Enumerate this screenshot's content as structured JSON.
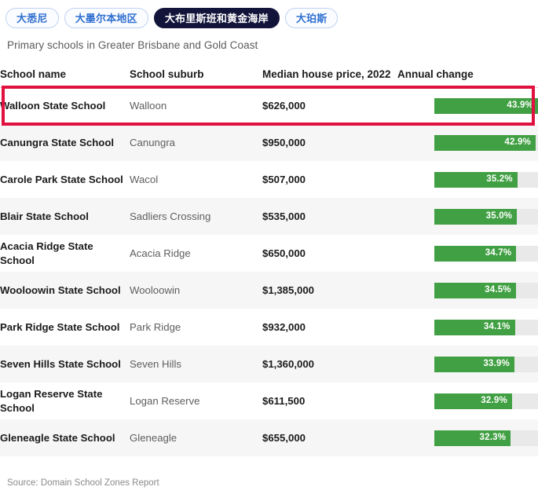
{
  "tabs": [
    {
      "label": "大悉尼",
      "active": false
    },
    {
      "label": "大墨尔本地区",
      "active": false
    },
    {
      "label": "大布里斯班和黄金海岸",
      "active": true
    },
    {
      "label": "大珀斯",
      "active": false
    }
  ],
  "subtitle": "Primary schools in Greater Brisbane and Gold Coast",
  "table": {
    "headers": {
      "school_name": "School name",
      "school_suburb": "School suburb",
      "median_price": "Median house price, 2022",
      "annual_change": "Annual change"
    },
    "rows": [
      {
        "school": "Walloon State School",
        "suburb": "Walloon",
        "price": "$626,000",
        "change_label": "43.9%",
        "change_value": 43.9,
        "highlighted": true
      },
      {
        "school": "Canungra State School",
        "suburb": "Canungra",
        "price": "$950,000",
        "change_label": "42.9%",
        "change_value": 42.9,
        "highlighted": false
      },
      {
        "school": "Carole Park State School",
        "suburb": "Wacol",
        "price": "$507,000",
        "change_label": "35.2%",
        "change_value": 35.2,
        "highlighted": false
      },
      {
        "school": "Blair State School",
        "suburb": "Sadliers Crossing",
        "price": "$535,000",
        "change_label": "35.0%",
        "change_value": 35.0,
        "highlighted": false
      },
      {
        "school": "Acacia Ridge State School",
        "suburb": "Acacia Ridge",
        "price": "$650,000",
        "change_label": "34.7%",
        "change_value": 34.7,
        "highlighted": false
      },
      {
        "school": "Wooloowin State School",
        "suburb": "Wooloowin",
        "price": "$1,385,000",
        "change_label": "34.5%",
        "change_value": 34.5,
        "highlighted": false
      },
      {
        "school": "Park Ridge State School",
        "suburb": "Park Ridge",
        "price": "$932,000",
        "change_label": "34.1%",
        "change_value": 34.1,
        "highlighted": false
      },
      {
        "school": "Seven Hills State School",
        "suburb": "Seven Hills",
        "price": "$1,360,000",
        "change_label": "33.9%",
        "change_value": 33.9,
        "highlighted": false
      },
      {
        "school": "Logan Reserve State School",
        "suburb": "Logan Reserve",
        "price": "$611,500",
        "change_label": "32.9%",
        "change_value": 32.9,
        "highlighted": false
      },
      {
        "school": "Gleneagle State School",
        "suburb": "Gleneagle",
        "price": "$655,000",
        "change_label": "32.3%",
        "change_value": 32.3,
        "highlighted": false
      }
    ]
  },
  "source": "Source: Domain School Zones Report",
  "colors": {
    "bar_fill": "#41a043",
    "bar_track": "#e9e9e9",
    "highlight_border": "#e0113f",
    "tab_active_bg": "#12143a",
    "tab_inactive_text": "#2f6fd0",
    "stripe_bg": "#f6f6f6"
  },
  "chart_data": {
    "type": "bar",
    "title": "Primary schools in Greater Brisbane and Gold Coast",
    "xlabel": "Annual change",
    "ylabel": "School name",
    "categories": [
      "Walloon State School",
      "Canungra State School",
      "Carole Park State School",
      "Blair State School",
      "Acacia Ridge State School",
      "Wooloowin State School",
      "Park Ridge State School",
      "Seven Hills State School",
      "Logan Reserve State School",
      "Gleneagle State School"
    ],
    "values": [
      43.9,
      42.9,
      35.2,
      35.0,
      34.7,
      34.5,
      34.1,
      33.9,
      32.9,
      32.3
    ],
    "value_labels": [
      "43.9%",
      "42.9%",
      "35.2%",
      "35.0%",
      "34.7%",
      "34.5%",
      "34.1%",
      "33.9%",
      "32.9%",
      "32.3%"
    ],
    "xlim": [
      0,
      43.9
    ],
    "grid": false,
    "legend": "none",
    "orientation": "horizontal",
    "series": [
      {
        "name": "Annual change",
        "values": [
          43.9,
          42.9,
          35.2,
          35.0,
          34.7,
          34.5,
          34.1,
          33.9,
          32.9,
          32.3
        ]
      },
      {
        "name": "Median house price, 2022",
        "values": [
          626000,
          950000,
          507000,
          535000,
          650000,
          1385000,
          932000,
          1360000,
          611500,
          655000
        ],
        "value_labels": [
          "$626,000",
          "$950,000",
          "$507,000",
          "$535,000",
          "$650,000",
          "$1,385,000",
          "$932,000",
          "$1,360,000",
          "$611,500",
          "$655,000"
        ]
      }
    ],
    "suburbs": [
      "Walloon",
      "Canungra",
      "Wacol",
      "Sadliers Crossing",
      "Acacia Ridge",
      "Wooloowin",
      "Park Ridge",
      "Seven Hills",
      "Logan Reserve",
      "Gleneagle"
    ],
    "source": "Source: Domain School Zones Report"
  }
}
